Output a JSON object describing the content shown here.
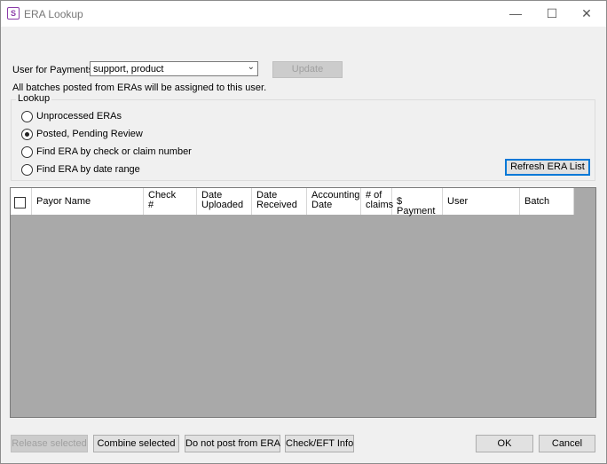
{
  "window": {
    "title": "ERA Lookup",
    "app_icon_glyph": "S"
  },
  "user": {
    "label": "User for Payments:",
    "selected": "support, product",
    "update_label": "Update",
    "note": "All batches posted from ERAs will be assigned to this user."
  },
  "lookup": {
    "title": "Lookup",
    "options": [
      {
        "label": "Unprocessed ERAs",
        "checked": false
      },
      {
        "label": "Posted, Pending Review",
        "checked": true
      },
      {
        "label": "Find ERA by check or claim number",
        "checked": false
      },
      {
        "label": "Find ERA by date range",
        "checked": false
      }
    ],
    "refresh_label": "Refresh ERA List"
  },
  "grid": {
    "columns": [
      [
        "Payor Name"
      ],
      [
        "Check",
        "#"
      ],
      [
        "Date",
        "Uploaded"
      ],
      [
        "Date",
        "Received"
      ],
      [
        "Accounting",
        "Date"
      ],
      [
        "# of",
        "claims"
      ],
      [
        "$ Payment"
      ],
      [
        "User"
      ],
      [
        "Batch"
      ]
    ],
    "rows": []
  },
  "footer": {
    "release_label": "Release selected",
    "combine_label": "Combine selected",
    "donotpost_label": "Do not post from ERA",
    "checkeft_label": "Check/EFT Info",
    "ok_label": "OK",
    "cancel_label": "Cancel"
  }
}
